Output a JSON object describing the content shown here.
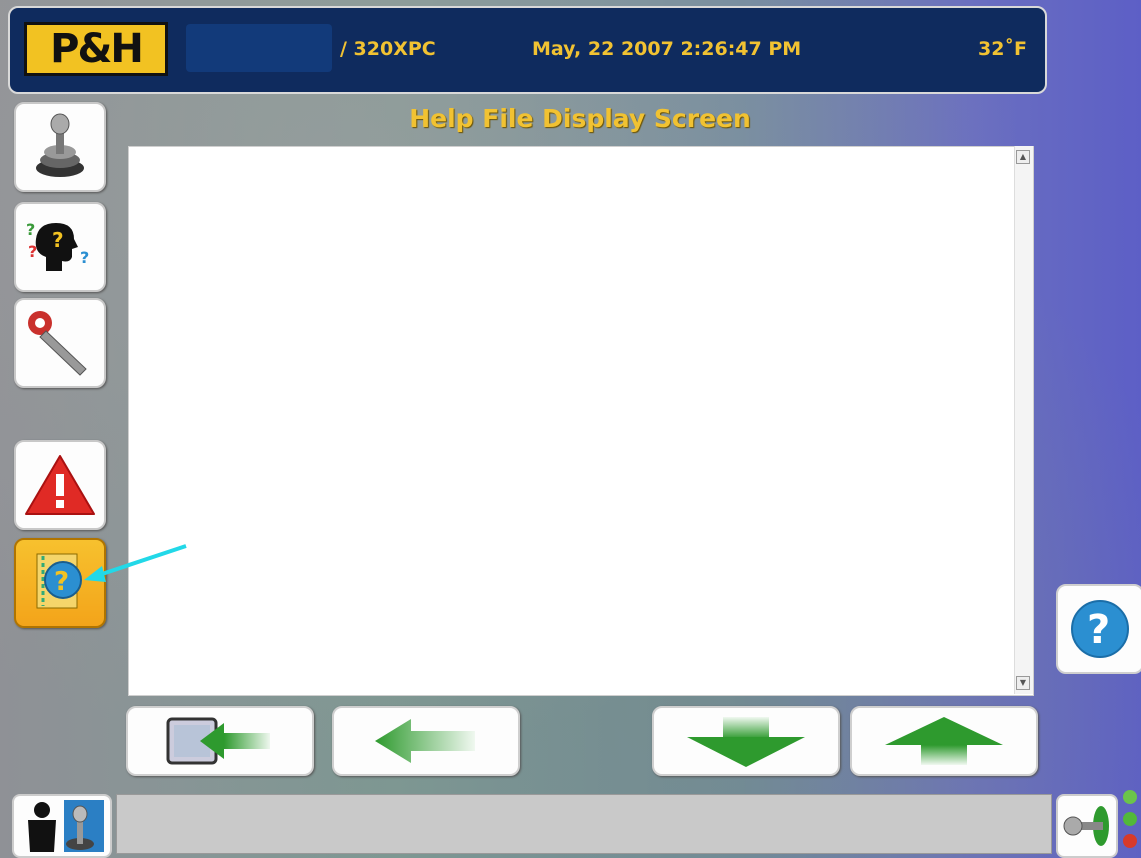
{
  "header": {
    "logo_text": "P&H",
    "model": "/ 320XPC",
    "datetime": "May, 22 2007 2:26:47 PM",
    "temperature": "32˚F"
  },
  "screen": {
    "title": "Help File Display Screen"
  },
  "sidebar": {
    "items": [
      {
        "name": "joystick-controls",
        "icon": "joystick-icon"
      },
      {
        "name": "help-questions",
        "icon": "thinking-head-icon"
      },
      {
        "name": "maintenance",
        "icon": "wrench-icon"
      },
      {
        "name": "alarms",
        "icon": "warning-triangle-icon"
      },
      {
        "name": "help-file",
        "icon": "help-book-icon",
        "active": true
      }
    ]
  },
  "nav": {
    "buttons": [
      {
        "name": "exit-help-button",
        "icon": "exit-arrow-icon"
      },
      {
        "name": "back-button",
        "icon": "left-arrow-icon"
      },
      {
        "name": "scroll-down-button",
        "icon": "down-arrow-icon"
      },
      {
        "name": "scroll-up-button",
        "icon": "up-arrow-icon"
      }
    ]
  },
  "scroll": {
    "up_glyph": "▲",
    "down_glyph": "▼"
  },
  "help_button": {
    "icon": "help-icon",
    "glyph": "?"
  },
  "status": {
    "text": ""
  },
  "bottom": {
    "left_icon": "operator-joystick-icon",
    "right_icon": "lever-icon"
  },
  "indicators": [
    {
      "name": "led-green-top",
      "color": "#6bc44a"
    },
    {
      "name": "led-green-bottom",
      "color": "#52b83a"
    },
    {
      "name": "led-red",
      "color": "#d73a2a"
    }
  ],
  "colors": {
    "header_bg": "#0f2b5e",
    "header_text": "#f1c232",
    "active_button": "#f3a41a",
    "arrow_green": "#2e9a2e",
    "help_blue": "#2b8fd1",
    "annotation_cyan": "#22d8e8"
  }
}
